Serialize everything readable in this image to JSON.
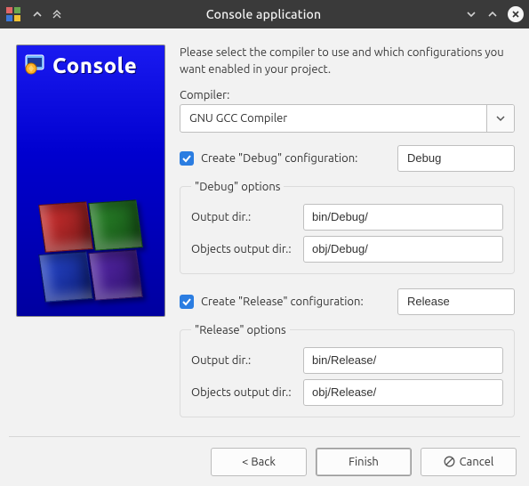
{
  "window": {
    "title": "Console application"
  },
  "banner": {
    "title": "Console"
  },
  "intro": "Please select the compiler to use and which configurations you want enabled in your project.",
  "compiler": {
    "label": "Compiler:",
    "value": "GNU GCC Compiler"
  },
  "debug": {
    "checkbox_label": "Create \"Debug\" configuration:",
    "name": "Debug",
    "group_title": "\"Debug\" options",
    "output_label": "Output dir.:",
    "output_value": "bin/Debug/",
    "objects_label": "Objects output dir.:",
    "objects_value": "obj/Debug/"
  },
  "release": {
    "checkbox_label": "Create \"Release\" configuration:",
    "name": "Release",
    "group_title": "\"Release\" options",
    "output_label": "Output dir.:",
    "output_value": "bin/Release/",
    "objects_label": "Objects output dir.:",
    "objects_value": "obj/Release/"
  },
  "footer": {
    "back": "< Back",
    "finish": "Finish",
    "cancel": "Cancel"
  }
}
